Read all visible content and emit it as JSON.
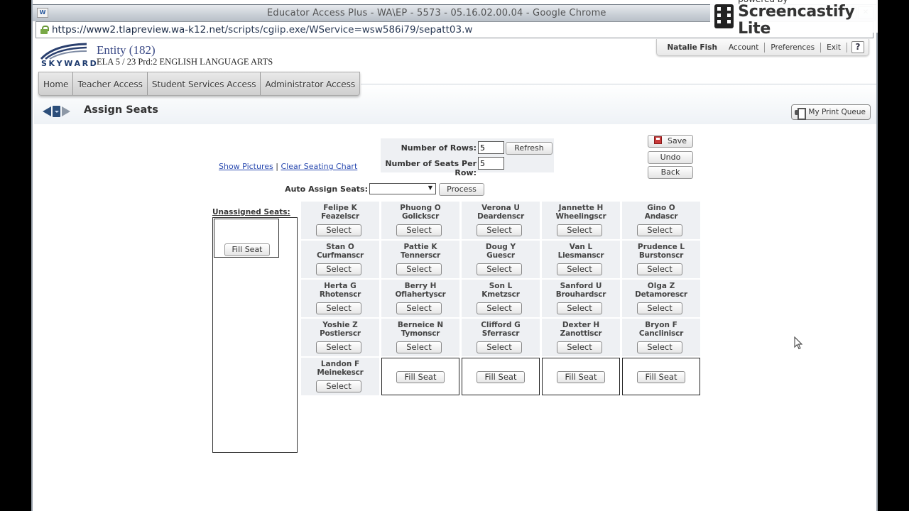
{
  "browser": {
    "window_title": "Educator Access Plus - WA\\EP - 5573 - 05.16.02.00.04 - Google Chrome",
    "url_host": "https://www2.tlapreview.wa-k12.net",
    "url_path": "/scripts/cgiip.exe/WService=wsw586i79/sepatt03.w",
    "controls": [
      "–",
      "▫",
      "✕"
    ]
  },
  "overlay": {
    "small": "powered by",
    "big": "Screencastify Lite"
  },
  "header": {
    "logo": "SKYWARD",
    "entity": "Entity (182)",
    "course": "ELA 5 / 23 Prd:2 ENGLISH LANGUAGE ARTS"
  },
  "usermenu": {
    "user": "Natalie Fish",
    "account": "Account",
    "preferences": "Preferences",
    "exit": "Exit",
    "help": "?"
  },
  "nav": {
    "tabs": [
      "Home",
      "Teacher Access",
      "Student Services Access",
      "Administrator Access"
    ]
  },
  "page": {
    "title": "Assign Seats",
    "print_queue": "My Print Queue"
  },
  "controls": {
    "rows_label": "Number of Rows:",
    "rows_value": "5",
    "seats_label": "Number of Seats Per Row:",
    "seats_value": "5",
    "refresh": "Refresh",
    "show_pictures": "Show Pictures",
    "separator": "|",
    "clear_chart": "Clear Seating Chart",
    "auto_assign_label": "Auto Assign Seats:",
    "auto_assign_value": "",
    "process": "Process",
    "save": "Save",
    "undo": "Undo",
    "back": "Back"
  },
  "unassigned": {
    "label": "Unassigned Seats:",
    "fill_seat": "Fill Seat"
  },
  "seats": [
    {
      "first": "Felipe K",
      "last": "Feazelscr",
      "button": "Select"
    },
    {
      "first": "Phuong O",
      "last": "Golickscr",
      "button": "Select"
    },
    {
      "first": "Verona U",
      "last": "Deardenscr",
      "button": "Select"
    },
    {
      "first": "Jannette H",
      "last": "Wheelingscr",
      "button": "Select"
    },
    {
      "first": "Gino O",
      "last": "Andascr",
      "button": "Select"
    },
    {
      "first": "Stan O",
      "last": "Curfmanscr",
      "button": "Select"
    },
    {
      "first": "Pattie K",
      "last": "Tennerscr",
      "button": "Select"
    },
    {
      "first": "Doug Y",
      "last": "Guescr",
      "button": "Select"
    },
    {
      "first": "Van L",
      "last": "Liesmanscr",
      "button": "Select"
    },
    {
      "first": "Prudence L",
      "last": "Burstonscr",
      "button": "Select"
    },
    {
      "first": "Herta G",
      "last": "Rhotenscr",
      "button": "Select"
    },
    {
      "first": "Berry H",
      "last": "Oflahertyscr",
      "button": "Select"
    },
    {
      "first": "Son L",
      "last": "Kmetzscr",
      "button": "Select"
    },
    {
      "first": "Sanford U",
      "last": "Brouhardscr",
      "button": "Select"
    },
    {
      "first": "Olga Z",
      "last": "Detamorescr",
      "button": "Select"
    },
    {
      "first": "Yoshie Z",
      "last": "Postierscr",
      "button": "Select"
    },
    {
      "first": "Berneice N",
      "last": "Tymonscr",
      "button": "Select"
    },
    {
      "first": "Clifford G",
      "last": "Sferrascr",
      "button": "Select"
    },
    {
      "first": "Dexter H",
      "last": "Zanottiscr",
      "button": "Select"
    },
    {
      "first": "Bryon F",
      "last": "Cancliniscr",
      "button": "Select"
    },
    {
      "first": "Landon F",
      "last": "Meinekescr",
      "button": "Select"
    }
  ],
  "empty_seats": [
    {
      "button": "Fill Seat"
    },
    {
      "button": "Fill Seat"
    },
    {
      "button": "Fill Seat"
    },
    {
      "button": "Fill Seat"
    }
  ]
}
